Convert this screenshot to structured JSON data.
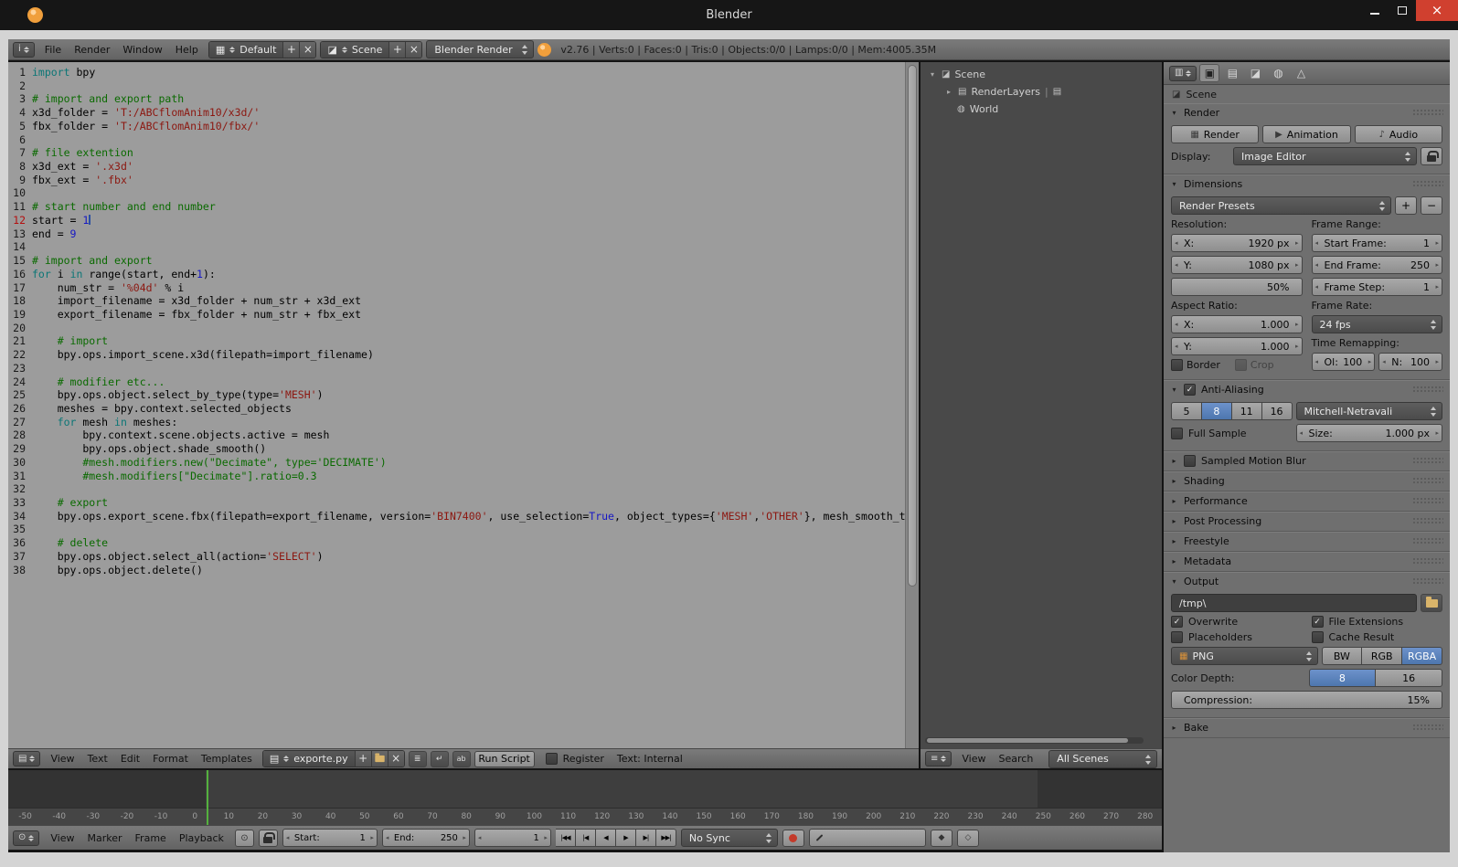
{
  "window": {
    "title": "Blender",
    "colors": {
      "selection_blue": "#5680c2",
      "close_red": "#d0402f",
      "logo_orange": "#f09f3c",
      "current_frame_green": "#54b13e"
    }
  },
  "infobar": {
    "menus": [
      "File",
      "Render",
      "Window",
      "Help"
    ],
    "layout": {
      "value": "Default"
    },
    "scene": {
      "value": "Scene"
    },
    "engine": {
      "value": "Blender Render"
    },
    "stats": "v2.76 | Verts:0 | Faces:0 | Tris:0 | Objects:0/0 | Lamps:0/0 | Mem:4005.35M"
  },
  "text_editor": {
    "cursor_line": 12,
    "lines": [
      [
        [
          "k",
          "import"
        ],
        [
          "p",
          " bpy"
        ]
      ],
      [],
      [
        [
          "c",
          "# import and export path"
        ]
      ],
      [
        [
          "p",
          "x3d_folder = "
        ],
        [
          "s",
          "'T:/ABCflomAnim10/x3d/'"
        ]
      ],
      [
        [
          "p",
          "fbx_folder = "
        ],
        [
          "s",
          "'T:/ABCflomAnim10/fbx/'"
        ]
      ],
      [],
      [
        [
          "c",
          "# file extention"
        ]
      ],
      [
        [
          "p",
          "x3d_ext = "
        ],
        [
          "s",
          "'.x3d'"
        ]
      ],
      [
        [
          "p",
          "fbx_ext = "
        ],
        [
          "s",
          "'.fbx'"
        ]
      ],
      [],
      [
        [
          "c",
          "# start number and end number"
        ]
      ],
      [
        [
          "p",
          "start = "
        ],
        [
          "n",
          "1"
        ]
      ],
      [
        [
          "p",
          "end = "
        ],
        [
          "n",
          "9"
        ]
      ],
      [],
      [
        [
          "c",
          "# import and export"
        ]
      ],
      [
        [
          "k",
          "for"
        ],
        [
          "p",
          " i "
        ],
        [
          "k",
          "in"
        ],
        [
          "p",
          " range(start, end+"
        ],
        [
          "n",
          "1"
        ],
        [
          "p",
          "):"
        ]
      ],
      [
        [
          "p",
          "    num_str = "
        ],
        [
          "s",
          "'%04d'"
        ],
        [
          "p",
          " % i"
        ]
      ],
      [
        [
          "p",
          "    import_filename = x3d_folder + num_str + x3d_ext"
        ]
      ],
      [
        [
          "p",
          "    export_filename = fbx_folder + num_str + fbx_ext"
        ]
      ],
      [],
      [
        [
          "c",
          "    # import"
        ]
      ],
      [
        [
          "p",
          "    bpy.ops.import_scene.x3d(filepath=import_filename)"
        ]
      ],
      [],
      [
        [
          "c",
          "    # modifier etc..."
        ]
      ],
      [
        [
          "p",
          "    bpy.ops.object.select_by_type(type="
        ],
        [
          "s",
          "'MESH'"
        ],
        [
          "p",
          ")"
        ]
      ],
      [
        [
          "p",
          "    meshes = bpy.context.selected_objects"
        ]
      ],
      [
        [
          "p",
          "    "
        ],
        [
          "k",
          "for"
        ],
        [
          "p",
          " mesh "
        ],
        [
          "k",
          "in"
        ],
        [
          "p",
          " meshes:"
        ]
      ],
      [
        [
          "p",
          "        bpy.context.scene.objects.active = mesh"
        ]
      ],
      [
        [
          "p",
          "        bpy.ops.object.shade_smooth()"
        ]
      ],
      [
        [
          "c",
          "        #mesh.modifiers.new(\"Decimate\", type='DECIMATE')"
        ]
      ],
      [
        [
          "c",
          "        #mesh.modifiers[\"Decimate\"].ratio=0.3"
        ]
      ],
      [],
      [
        [
          "c",
          "    # export"
        ]
      ],
      [
        [
          "p",
          "    bpy.ops.export_scene.fbx(filepath=export_filename, version="
        ],
        [
          "s",
          "'BIN7400'"
        ],
        [
          "p",
          ", use_selection="
        ],
        [
          "n",
          "True"
        ],
        [
          "p",
          ", object_types={"
        ],
        [
          "s",
          "'MESH'"
        ],
        [
          "p",
          ","
        ],
        [
          "s",
          "'OTHER'"
        ],
        [
          "p",
          "}, mesh_smooth_ty"
        ]
      ],
      [],
      [
        [
          "c",
          "    # delete"
        ]
      ],
      [
        [
          "p",
          "    bpy.ops.object.select_all(action="
        ],
        [
          "s",
          "'SELECT'"
        ],
        [
          "p",
          ")"
        ]
      ],
      [
        [
          "p",
          "    bpy.ops.object.delete()"
        ]
      ]
    ],
    "footer": {
      "menus": [
        "View",
        "Text",
        "Edit",
        "Format",
        "Templates"
      ],
      "filename": "exporte.py",
      "run_button": "Run Script",
      "register_label": "Register",
      "status": "Text: Internal"
    }
  },
  "outliner": {
    "items": [
      {
        "label": "Scene"
      },
      {
        "label": "RenderLayers"
      },
      {
        "label": "World"
      }
    ],
    "footer": {
      "menus": [
        "View",
        "Search"
      ],
      "filter": "All Scenes"
    }
  },
  "properties": {
    "breadcrumb": "Scene",
    "render": {
      "title": "Render",
      "buttons": {
        "render": "Render",
        "animation": "Animation",
        "audio": "Audio"
      },
      "display_label": "Display:",
      "display_value": "Image Editor"
    },
    "dimensions": {
      "title": "Dimensions",
      "presets": "Render Presets",
      "resolution_label": "Resolution:",
      "res_x": {
        "label": "X:",
        "value": "1920 px"
      },
      "res_y": {
        "label": "Y:",
        "value": "1080 px"
      },
      "res_scale": "50%",
      "frame_range_label": "Frame Range:",
      "start_frame": {
        "label": "Start Frame:",
        "value": "1"
      },
      "end_frame": {
        "label": "End Frame:",
        "value": "250"
      },
      "frame_step": {
        "label": "Frame Step:",
        "value": "1"
      },
      "aspect_label": "Aspect Ratio:",
      "aspect_x": {
        "label": "X:",
        "value": "1.000"
      },
      "aspect_y": {
        "label": "Y:",
        "value": "1.000"
      },
      "border_label": "Border",
      "crop_label": "Crop",
      "frame_rate_label": "Frame Rate:",
      "frame_rate": "24 fps",
      "time_remapping_label": "Time Remapping:",
      "map_old": {
        "label": "Ol:",
        "value": "100"
      },
      "map_new": {
        "label": "N:",
        "value": "100"
      }
    },
    "anti_aliasing": {
      "title": "Anti-Aliasing",
      "samples": [
        "5",
        "8",
        "11",
        "16"
      ],
      "selected_sample": "8",
      "filter": "Mitchell-Netravali",
      "full_sample_label": "Full Sample",
      "size": {
        "label": "Size:",
        "value": "1.000 px"
      }
    },
    "sampled_motion_blur": {
      "title": "Sampled Motion Blur"
    },
    "collapsed": [
      {
        "title": "Shading"
      },
      {
        "title": "Performance"
      },
      {
        "title": "Post Processing"
      },
      {
        "title": "Freestyle"
      },
      {
        "title": "Metadata"
      }
    ],
    "output": {
      "title": "Output",
      "path": "/tmp\\",
      "overwrite_label": "Overwrite",
      "file_extensions_label": "File Extensions",
      "placeholders_label": "Placeholders",
      "cache_result_label": "Cache Result",
      "format": "PNG",
      "channels": [
        "BW",
        "RGB",
        "RGBA"
      ],
      "selected_channel": "RGBA",
      "color_depth_label": "Color Depth:",
      "depths": [
        "8",
        "16"
      ],
      "selected_depth": "8",
      "compression": {
        "label": "Compression:",
        "value": "15%"
      }
    },
    "bake": {
      "title": "Bake"
    }
  },
  "timeline": {
    "ruler": [
      "-50",
      "-40",
      "-30",
      "-20",
      "-10",
      "0",
      "10",
      "20",
      "30",
      "40",
      "50",
      "60",
      "70",
      "80",
      "90",
      "100",
      "110",
      "120",
      "130",
      "140",
      "150",
      "160",
      "170",
      "180",
      "190",
      "200",
      "210",
      "220",
      "230",
      "240",
      "250",
      "260",
      "270",
      "280"
    ],
    "footer": {
      "menus": [
        "View",
        "Marker",
        "Frame",
        "Playback"
      ],
      "start": {
        "label": "Start:",
        "value": "1"
      },
      "end": {
        "label": "End:",
        "value": "250"
      },
      "current": "1",
      "playback": [
        {
          "name": "jump-to-start",
          "glyph": "|◀◀"
        },
        {
          "name": "jump-to-prev-keyframe",
          "glyph": "|◀"
        },
        {
          "name": "play-reverse",
          "glyph": "◀"
        },
        {
          "name": "play",
          "glyph": "▶"
        },
        {
          "name": "jump-to-next-keyframe",
          "glyph": "▶|"
        },
        {
          "name": "jump-to-end",
          "glyph": "▶▶|"
        }
      ],
      "sync": "No Sync"
    }
  },
  "icons": {
    "info-editor": "i",
    "text-editor": "▤",
    "outliner-editor": "≡",
    "timeline-editor": "⊙",
    "properties-editor": "▥",
    "screen-layout": "▦",
    "scene-datablock": "◪",
    "text-datablock": "▤",
    "tab-render": "▣",
    "tab-render-layers": "▤",
    "tab-scene": "◪",
    "tab-world": "◍",
    "tab-object": "△",
    "scene-item": "◪",
    "render-layers-item": "▤",
    "world-item": "◍",
    "render-button": "▦",
    "animation-button": "▶",
    "audio-button": "♪",
    "png-format": "▦",
    "line-numbers-toggle": "≣",
    "word-wrap-toggle": "↵",
    "syntax-toggle": "ab",
    "expand-open": "▾",
    "expand-closed": "▸",
    "preview-range": "⊙",
    "insert-keyframe": "◆",
    "delete-keyframe": "◇"
  }
}
